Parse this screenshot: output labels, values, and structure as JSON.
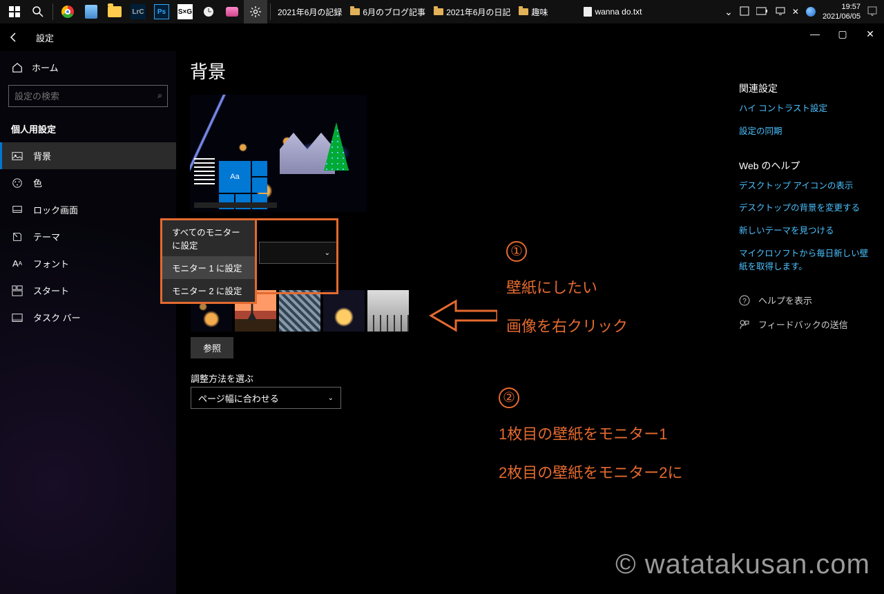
{
  "taskbar": {
    "tabs": [
      {
        "label": "2021年6月の記録"
      },
      {
        "label": "6月のブログ記事",
        "type": "folder"
      },
      {
        "label": "2021年6月の日記",
        "type": "folder"
      },
      {
        "label": "趣味",
        "type": "folder"
      },
      {
        "label": "wanna do.txt",
        "type": "file"
      }
    ],
    "clock_time": "19:57",
    "clock_date": "2021/06/05"
  },
  "header": {
    "app_title": "設定"
  },
  "sidebar": {
    "home": "ホーム",
    "search_placeholder": "設定の検索",
    "section": "個人用設定",
    "items": [
      {
        "label": "背景",
        "active": true
      },
      {
        "label": "色"
      },
      {
        "label": "ロック画面"
      },
      {
        "label": "テーマ"
      },
      {
        "label": "フォント"
      },
      {
        "label": "スタート"
      },
      {
        "label": "タスク バー"
      }
    ]
  },
  "main": {
    "title": "背景",
    "preview_tile_text": "Aa",
    "context_menu": {
      "items": [
        "すべてのモニターに設定",
        "モニター 1 に設定",
        "モニター 2 に設定"
      ]
    },
    "browse": "参照",
    "fit_label": "調整方法を選ぶ",
    "fit_value": "ページ幅に合わせる"
  },
  "rail": {
    "h1": "関連設定",
    "links1": [
      "ハイ コントラスト設定",
      "設定の同期"
    ],
    "h2": "Web のヘルプ",
    "links2": [
      "デスクトップ アイコンの表示",
      "デスクトップの背景を変更する",
      "新しいテーマを見つける",
      "マイクロソフトから毎日新しい壁紙を取得します。"
    ],
    "help": "ヘルプを表示",
    "feedback": "フィードバックの送信"
  },
  "annotations": {
    "n1": "①",
    "t1a": "壁紙にしたい",
    "t1b": "画像を右クリック",
    "n2": "②",
    "t2a": "1枚目の壁紙をモニター1",
    "t2b": "2枚目の壁紙をモニター2に"
  },
  "watermark": "© watatakusan.com"
}
